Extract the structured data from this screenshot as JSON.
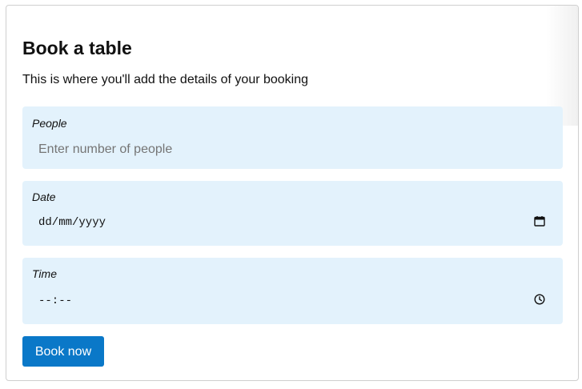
{
  "form": {
    "title": "Book a table",
    "subtitle": "This is where you'll add the details of your booking",
    "people": {
      "label": "People",
      "placeholder": "Enter number of people"
    },
    "date": {
      "label": "Date",
      "placeholder": "dd/mm/yyyy",
      "icon": "calendar-icon"
    },
    "time": {
      "label": "Time",
      "placeholder": "--:--",
      "icon": "clock-icon"
    },
    "submit_label": "Book now"
  },
  "colors": {
    "field_background": "#e3f2fc",
    "button_background": "#0a78c8",
    "button_text": "#ffffff"
  }
}
